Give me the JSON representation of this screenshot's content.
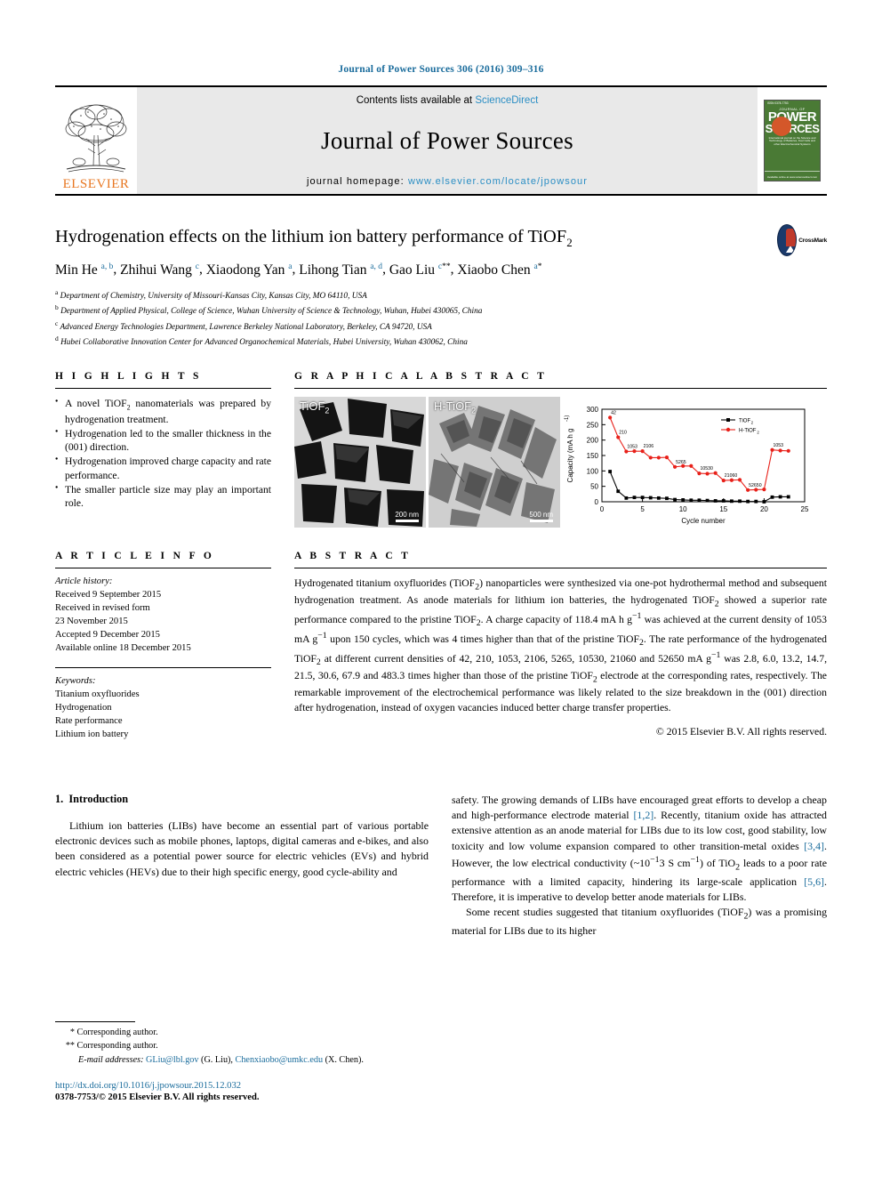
{
  "journal_ref": "Journal of Power Sources 306 (2016) 309–316",
  "masthead": {
    "contents_text": "Contents lists available at ",
    "sciencedirect": "ScienceDirect",
    "journal_name": "Journal of Power Sources",
    "homepage_label": "journal homepage: ",
    "homepage_url": "www.elsevier.com/locate/jpowsour",
    "publisher": "ELSEVIER",
    "cover": {
      "kicker": "ISSN 0378-7753",
      "line1": "JOURNAL OF",
      "line2": "POWER",
      "line3": "SOURCES",
      "blurb": "International journal on the Science and Technology of Batteries, Fuel Cells and other Electrochemical Systems",
      "footer": "Available online at www.sciencedirect.com"
    }
  },
  "article": {
    "title_main": "Hydrogenation effects on the lithium ion battery performance of TiOF",
    "title_sub": "2",
    "crossmark_label": "CrossMark",
    "authors": [
      {
        "name": "Min He",
        "sup": "a, b"
      },
      {
        "name": "Zhihui Wang",
        "sup": "c"
      },
      {
        "name": "Xiaodong Yan",
        "sup": "a"
      },
      {
        "name": "Lihong Tian",
        "sup": "a, d"
      },
      {
        "name": "Gao Liu",
        "sup": "c",
        "star": "**"
      },
      {
        "name": "Xiaobo Chen",
        "sup": "a",
        "star": "*"
      }
    ],
    "affiliations": [
      {
        "mark": "a",
        "text": "Department of Chemistry, University of Missouri-Kansas City, Kansas City, MO 64110, USA"
      },
      {
        "mark": "b",
        "text": "Department of Applied Physical, College of Science, Wuhan University of Science & Technology, Wuhan, Hubei 430065, China"
      },
      {
        "mark": "c",
        "text": "Advanced Energy Technologies Department, Lawrence Berkeley National Laboratory, Berkeley, CA 94720, USA"
      },
      {
        "mark": "d",
        "text": "Hubei Collaborative Innovation Center for Advanced Organochemical Materials, Hubei University, Wuhan 430062, China"
      }
    ]
  },
  "highlights": {
    "heading": "H I G H L I G H T S",
    "items": [
      "A novel TiOF2 nanomaterials was prepared by hydrogenation treatment.",
      "Hydrogenation led to the smaller thickness in the (001) direction.",
      "Hydrogenation improved charge capacity and rate performance.",
      "The smaller particle size may play an important role."
    ]
  },
  "graphical_abstract": {
    "heading": "G R A P H I C A L  A B S T R A C T",
    "tem_left_label": "TiOF",
    "tem_left_sub": "2",
    "tem_left_scale": "200 nm",
    "tem_right_label": "H-TiOF",
    "tem_right_sub": "2",
    "tem_right_scale": "500 nm"
  },
  "chart_data": {
    "type": "line",
    "title": "",
    "xlabel": "Cycle number",
    "ylabel": "Capacity (mA h g-1)",
    "xlim": [
      0,
      25
    ],
    "ylim": [
      0,
      300
    ],
    "xticks": [
      0,
      5,
      10,
      15,
      20,
      25
    ],
    "yticks": [
      0,
      50,
      100,
      150,
      200,
      250,
      300
    ],
    "grid": false,
    "legend_position": "top-right",
    "annotations": [
      "42",
      "210",
      "1053",
      "2106",
      "5265",
      "10530",
      "21060",
      "52650",
      "1053"
    ],
    "series": [
      {
        "name": "TiOF2",
        "color": "#000000",
        "marker": "square",
        "x": [
          1,
          2,
          3,
          4,
          5,
          6,
          7,
          8,
          9,
          10,
          11,
          12,
          13,
          14,
          15,
          16,
          17,
          18,
          19,
          20,
          21,
          22,
          23
        ],
        "y": [
          98,
          34,
          12,
          14,
          14,
          13,
          12,
          11,
          7,
          6,
          5,
          5,
          4,
          3,
          3,
          2,
          2,
          1,
          1,
          0,
          15,
          16,
          16
        ]
      },
      {
        "name": "H-TiOF2",
        "color": "#e8211a",
        "marker": "circle",
        "x": [
          1,
          2,
          3,
          4,
          5,
          6,
          7,
          8,
          9,
          10,
          11,
          12,
          13,
          14,
          15,
          16,
          17,
          18,
          19,
          20,
          21,
          22,
          23
        ],
        "y": [
          273,
          209,
          163,
          164,
          164,
          143,
          143,
          144,
          113,
          116,
          116,
          92,
          91,
          93,
          69,
          70,
          71,
          38,
          39,
          40,
          168,
          166,
          165
        ]
      }
    ]
  },
  "article_info": {
    "heading": "A R T I C L E  I N F O",
    "history_label": "Article history:",
    "history": [
      "Received 9 September 2015",
      "Received in revised form",
      "23 November 2015",
      "Accepted 9 December 2015",
      "Available online 18 December 2015"
    ],
    "keywords_label": "Keywords:",
    "keywords": [
      "Titanium oxyfluorides",
      "Hydrogenation",
      "Rate performance",
      "Lithium ion battery"
    ]
  },
  "abstract": {
    "heading": "A B S T R A C T",
    "paragraph_1": "Hydrogenated titanium oxyfluorides (TiOF2) nanoparticles were synthesized via one-pot hydrothermal method and subsequent hydrogenation treatment. As anode materials for lithium ion batteries, the hydrogenated TiOF2 showed a superior rate performance compared to the pristine TiOF2. A charge capacity of 118.4 mA h g−1 was achieved at the current density of 1053 mA g−1 upon 150 cycles, which was 4 times higher than that of the pristine TiOF2. The rate performance of the hydrogenated TiOF2 at different current densities of 42, 210, 1053, 2106, 5265, 10530, 21060 and 52650 mA g−1 was 2.8, 6.0, 13.2, 14.7, 21.5, 30.6, 67.9 and 483.3 times higher than those of the pristine TiOF2 electrode at the corresponding rates, respectively. The remarkable improvement of the electrochemical performance was likely related to the size breakdown in the (001) direction after hydrogenation, instead of oxygen vacancies induced better charge transfer properties.",
    "copyright": "© 2015 Elsevier B.V. All rights reserved."
  },
  "body": {
    "section_number": "1.",
    "section_title": "Introduction",
    "left_paragraph": "Lithium ion batteries (LIBs) have become an essential part of various portable electronic devices such as mobile phones, laptops, digital cameras and e-bikes, and also been considered as a potential power source for electric vehicles (EVs) and hybrid electric vehicles (HEVs) due to their high specific energy, good cycle-ability and",
    "right_paragraph_1_a": "safety. The growing demands of LIBs have encouraged great efforts to develop a cheap and high-performance electrode material ",
    "right_ref_1": "[1,2]",
    "right_paragraph_1_b": ". Recently, titanium oxide has attracted extensive attention as an anode material for LIBs due to its low cost, good stability, low toxicity and low volume expansion compared to other transition-metal oxides ",
    "right_ref_2": "[3,4]",
    "right_paragraph_1_c": ". However, the low electrical conductivity (~10−13 S cm−1) of TiO2 leads to a poor rate performance with a limited capacity, hindering its large-scale application ",
    "right_ref_3": "[5,6]",
    "right_paragraph_1_d": ". Therefore, it is imperative to develop better anode materials for LIBs.",
    "right_paragraph_2": "Some recent studies suggested that titanium oxyfluorides (TiOF2) was a promising material for LIBs due to its higher"
  },
  "footer": {
    "corr_1": "Corresponding author.",
    "corr_1_mark": "*",
    "corr_2": "Corresponding author.",
    "corr_2_mark": "**",
    "email_label": "E-mail addresses:",
    "email_1": "GLiu@lbl.gov",
    "email_1_owner": "(G. Liu),",
    "email_2": "Chenxiaobo@umkc.edu",
    "email_2_owner": "(X. Chen).",
    "doi": "http://dx.doi.org/10.1016/j.jpowsour.2015.12.032",
    "issn_line": "0378-7753/© 2015 Elsevier B.V. All rights reserved."
  },
  "colors": {
    "link": "#1a6c9c",
    "sciencedirect": "#2b8ec4",
    "elsevier_orange": "#E87722",
    "series_red": "#e8211a",
    "series_black": "#000000"
  }
}
